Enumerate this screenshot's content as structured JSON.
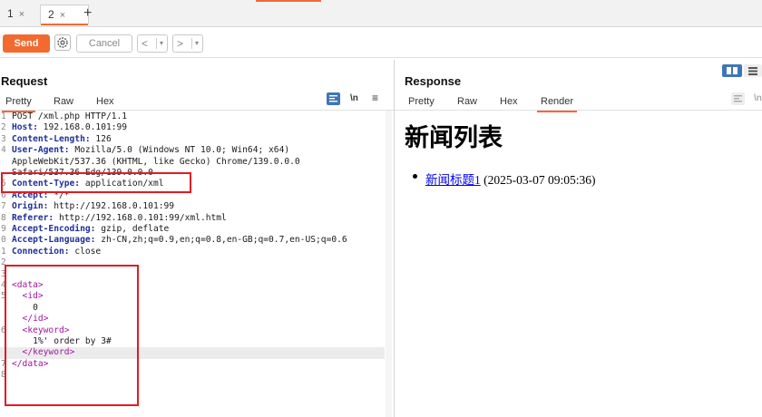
{
  "tabs": [
    {
      "label": "1",
      "close": "×"
    },
    {
      "label": "2",
      "close": "×"
    }
  ],
  "new_tab": "+",
  "toolbar": {
    "send_label": "Send",
    "cancel_label": "Cancel",
    "back_label": "<",
    "forward_label": ">",
    "dropdown_glyph": "▾"
  },
  "request": {
    "title": "Request",
    "tabs": [
      "Pretty",
      "Raw",
      "Hex"
    ],
    "active_tab": "Pretty",
    "ln_toggle": "\\n",
    "menu_glyph": "≡",
    "lines": [
      {
        "n": "1",
        "parts": [
          {
            "t": "POST /xml.php HTTP/1.1",
            "c": ""
          }
        ]
      },
      {
        "n": "2",
        "parts": [
          {
            "t": "Host:",
            "c": "hdr"
          },
          {
            "t": " 192.168.0.101:99",
            "c": ""
          }
        ]
      },
      {
        "n": "3",
        "parts": [
          {
            "t": "Content-Length:",
            "c": "hdr"
          },
          {
            "t": " 126",
            "c": ""
          }
        ]
      },
      {
        "n": "4",
        "parts": [
          {
            "t": "User-Agent:",
            "c": "hdr"
          },
          {
            "t": " Mozilla/5.0 (Windows NT 10.0; Win64; x64)",
            "c": ""
          }
        ]
      },
      {
        "n": "",
        "parts": [
          {
            "t": "AppleWebKit/537.36 (KHTML, like Gecko) Chrome/139.0.0.0",
            "c": ""
          }
        ]
      },
      {
        "n": "",
        "parts": [
          {
            "t": "Safari/537.36 Edg/139.0.0.0",
            "c": ""
          }
        ]
      },
      {
        "n": "5",
        "parts": [
          {
            "t": "Content-Type:",
            "c": "hdr"
          },
          {
            "t": " application/xml",
            "c": ""
          }
        ]
      },
      {
        "n": "6",
        "parts": [
          {
            "t": "Accept:",
            "c": "hdr"
          },
          {
            "t": " */*",
            "c": ""
          }
        ]
      },
      {
        "n": "7",
        "parts": [
          {
            "t": "Origin:",
            "c": "hdr"
          },
          {
            "t": " http://192.168.0.101:99",
            "c": ""
          }
        ]
      },
      {
        "n": "8",
        "parts": [
          {
            "t": "Referer:",
            "c": "hdr"
          },
          {
            "t": " http://192.168.0.101:99/xml.html",
            "c": ""
          }
        ]
      },
      {
        "n": "9",
        "parts": [
          {
            "t": "Accept-Encoding:",
            "c": "hdr"
          },
          {
            "t": " gzip, deflate",
            "c": ""
          }
        ]
      },
      {
        "n": "0",
        "parts": [
          {
            "t": "Accept-Language:",
            "c": "hdr"
          },
          {
            "t": " zh-CN,zh;q=0.9,en;q=0.8,en-GB;q=0.7,en-US;q=0.6",
            "c": ""
          }
        ]
      },
      {
        "n": "1",
        "parts": [
          {
            "t": "Connection:",
            "c": "hdr"
          },
          {
            "t": " close",
            "c": ""
          }
        ]
      },
      {
        "n": "2",
        "parts": [
          {
            "t": "",
            "c": ""
          }
        ]
      },
      {
        "n": "3",
        "parts": [
          {
            "t": "",
            "c": ""
          }
        ]
      },
      {
        "n": "4",
        "parts": [
          {
            "t": "<data>",
            "c": "tag"
          }
        ]
      },
      {
        "n": "5",
        "parts": [
          {
            "t": "  <id>",
            "c": "tag"
          }
        ]
      },
      {
        "n": "",
        "parts": [
          {
            "t": "    0",
            "c": ""
          }
        ]
      },
      {
        "n": "",
        "parts": [
          {
            "t": "  </id>",
            "c": "tag"
          }
        ]
      },
      {
        "n": "6",
        "parts": [
          {
            "t": "  <keyword>",
            "c": "tag"
          }
        ]
      },
      {
        "n": "",
        "parts": [
          {
            "t": "    1%' order by 3#",
            "c": ""
          }
        ]
      },
      {
        "n": "",
        "parts": [
          {
            "t": "  </keyword>",
            "c": "tag"
          }
        ],
        "highlight": true
      },
      {
        "n": "7",
        "parts": [
          {
            "t": "</data>",
            "c": "tag"
          }
        ]
      },
      {
        "n": "8",
        "parts": [
          {
            "t": "",
            "c": ""
          }
        ]
      }
    ]
  },
  "response": {
    "title": "Response",
    "tabs": [
      "Pretty",
      "Raw",
      "Hex",
      "Render"
    ],
    "active_tab": "Render",
    "heading": "新闻列表",
    "items": [
      {
        "link": "新闻标题1",
        "meta": " (2025-03-07 09:05:36)"
      }
    ]
  },
  "colors": {
    "accent": "#f06a35",
    "highlight_box": "#e01b24",
    "header_key": "#1f2f9a",
    "xml_tag": "#a0149f"
  }
}
